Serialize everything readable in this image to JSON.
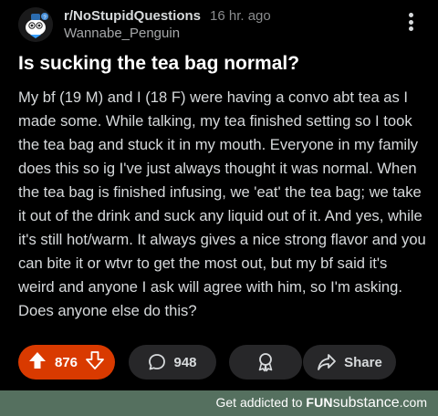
{
  "post": {
    "subreddit": "r/NoStupidQuestions",
    "time": "16 hr. ago",
    "username": "Wannabe_Penguin",
    "title": "Is sucking the tea bag normal?",
    "body": "My bf (19 M) and I (18 F) were having a convo abt tea as I made some. While talking, my tea finished setting so I took the tea bag and stuck it in my mouth. Everyone in my family does this so ig I've just always thought it was normal. When the tea bag is finished infusing, we 'eat' the tea bag; we take it out of the drink and suck any liquid out of it. And yes, while it's still hot/warm. It always gives a nice strong flavor and you can bite it or wtvr to get the most out, but my bf said it's weird and anyone I ask will agree with him, so I'm asking. Does anyone else do this?"
  },
  "actions": {
    "upvotes": "876",
    "comments": "948",
    "share_label": "Share"
  },
  "colors": {
    "vote_accent": "#d93a00",
    "pill_bg": "#272729",
    "footer_bg": "#55705f"
  },
  "icons": {
    "upvote": "arrow-up-icon",
    "downvote": "arrow-down-icon",
    "comments": "speech-bubble-icon",
    "award": "award-icon",
    "share": "share-arrow-icon",
    "more": "more-vertical-icon"
  },
  "footer": {
    "prefix": "Get addicted to ",
    "brand_fun": "FUN",
    "brand_substance": "substance",
    "brand_suffix": ".com"
  }
}
